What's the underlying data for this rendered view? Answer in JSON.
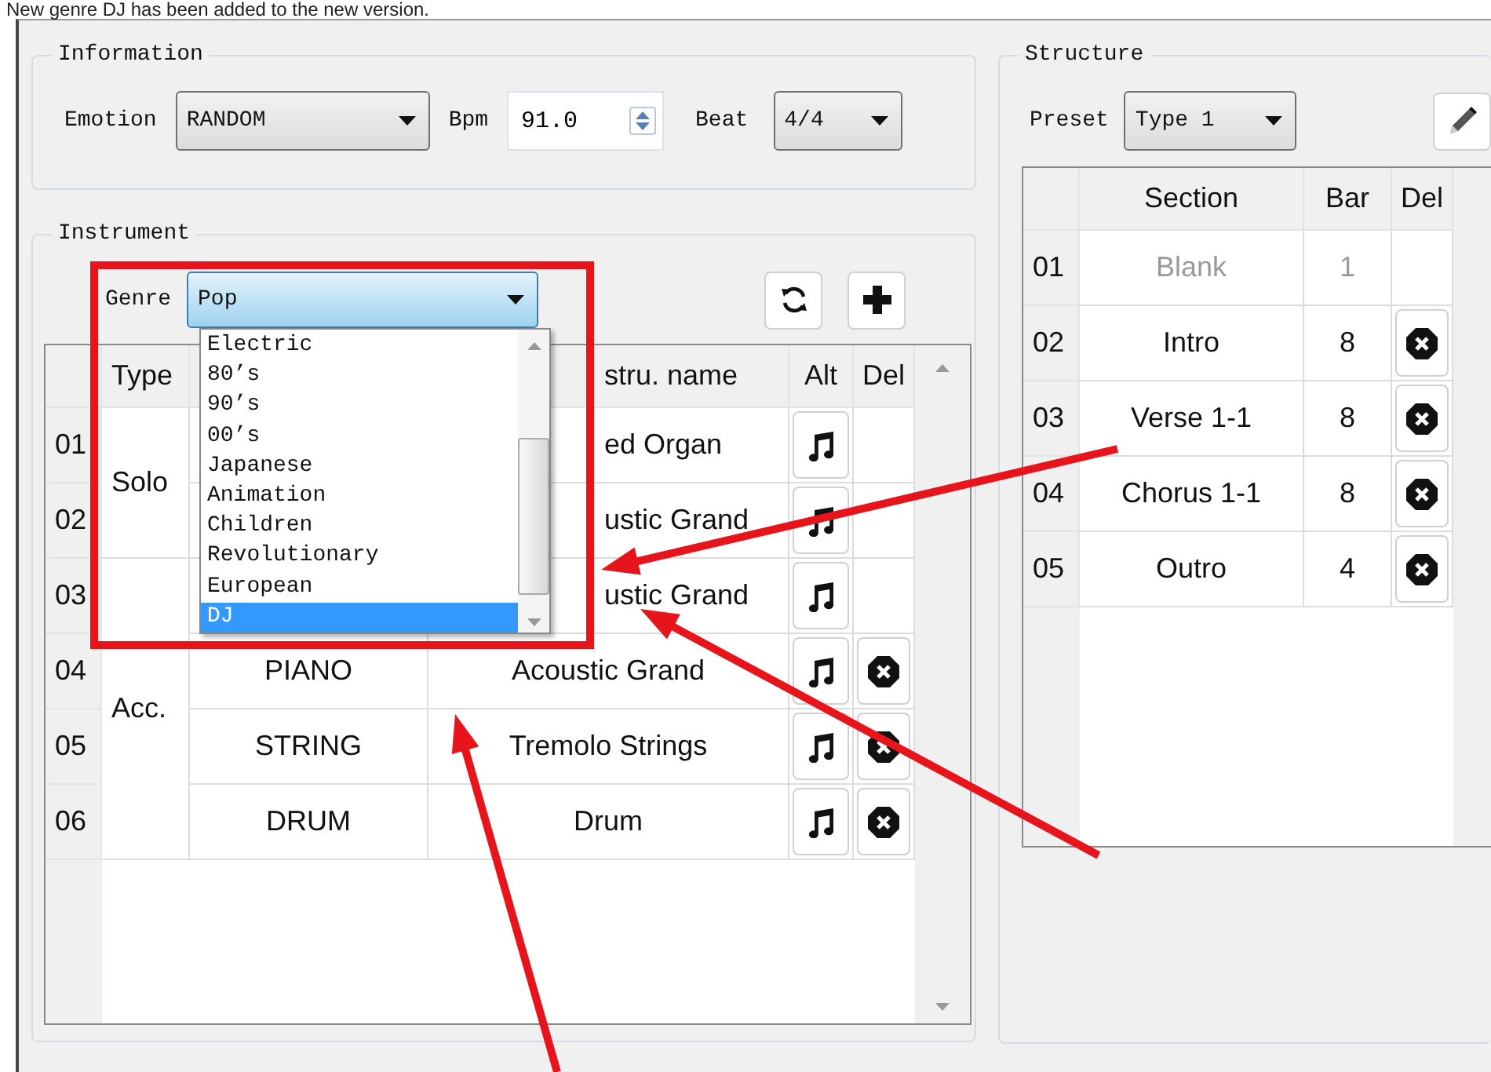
{
  "caption": "New genre DJ has been added to the new version.",
  "information": {
    "title": "Information",
    "emotion_label": "Emotion",
    "emotion_value": "RANDOM",
    "bpm_label": "Bpm",
    "bpm_value": "91.0",
    "beat_label": "Beat",
    "beat_value": "4/4"
  },
  "instrument": {
    "title": "Instrument",
    "genre_label": "Genre",
    "genre_value": "Pop",
    "genre_options": [
      {
        "label": "Electric",
        "selected": false
      },
      {
        "label": "80’s",
        "selected": false
      },
      {
        "label": "90’s",
        "selected": false
      },
      {
        "label": "00’s",
        "selected": false
      },
      {
        "label": "Japanese",
        "selected": false
      },
      {
        "label": "Animation",
        "selected": false
      },
      {
        "label": "Children",
        "selected": false
      },
      {
        "label": "Revolutionary",
        "selected": false
      },
      {
        "label": "European",
        "selected": false
      },
      {
        "label": "DJ",
        "selected": true
      }
    ],
    "header": {
      "type": "Type",
      "name": "stru. name",
      "alt": "Alt",
      "del": "Del"
    },
    "type_groups": [
      {
        "label": "Solo",
        "rows": [
          {
            "num": "01",
            "name": "ed Organ",
            "deletable": false
          },
          {
            "num": "02",
            "name": "ustic Grand",
            "deletable": false
          }
        ]
      },
      {
        "label": "Acc.",
        "rows": [
          {
            "num": "03",
            "name": "ustic Grand",
            "deletable": false
          },
          {
            "num": "04",
            "instrument": "PIANO",
            "name": "Acoustic Grand",
            "deletable": true
          },
          {
            "num": "05",
            "instrument": "STRING",
            "name": "Tremolo Strings",
            "deletable": true
          },
          {
            "num": "06",
            "instrument": "DRUM",
            "name": "Drum",
            "deletable": true
          }
        ]
      }
    ]
  },
  "structure": {
    "title": "Structure",
    "preset_label": "Preset",
    "preset_value": "Type 1",
    "header": {
      "section": "Section",
      "bar": "Bar",
      "del": "Del"
    },
    "rows": [
      {
        "num": "01",
        "section": "Blank",
        "bar": "1",
        "disabled": true,
        "deletable": false
      },
      {
        "num": "02",
        "section": "Intro",
        "bar": "8",
        "disabled": false,
        "deletable": true
      },
      {
        "num": "03",
        "section": "Verse 1-1",
        "bar": "8",
        "disabled": false,
        "deletable": true
      },
      {
        "num": "04",
        "section": "Chorus 1-1",
        "bar": "8",
        "disabled": false,
        "deletable": true
      },
      {
        "num": "05",
        "section": "Outro",
        "bar": "4",
        "disabled": false,
        "deletable": true
      }
    ]
  }
}
